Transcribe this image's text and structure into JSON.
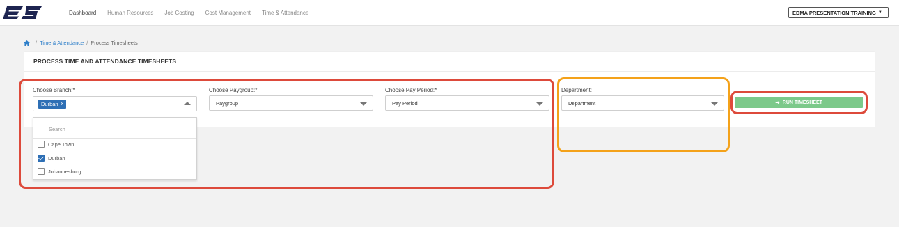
{
  "app": {
    "logo_text": "ES"
  },
  "nav": {
    "items": [
      "Dashboard",
      "Human Resources",
      "Job Costing",
      "Cost Management",
      "Time & Attendance"
    ],
    "active_index": 0
  },
  "company": {
    "label": "EDMA PRESENTATION TRAINING"
  },
  "breadcrumb": {
    "home_icon": "home-icon",
    "section": "Time & Attendance",
    "current": "Process Timesheets"
  },
  "page": {
    "title": "PROCESS TIME AND ATTENDANCE TIMESHEETS"
  },
  "form": {
    "branch": {
      "label": "Choose Branch:*",
      "selected_chip": "Durban",
      "chip_remove": "x"
    },
    "paygroup": {
      "label": "Choose Paygroup:*",
      "value": "Paygroup"
    },
    "pay_period": {
      "label": "Choose Pay Period:*",
      "value": "Pay Period"
    },
    "department": {
      "label": "Department:",
      "value": "Department"
    }
  },
  "branch_dropdown": {
    "search_placeholder": "Search",
    "options": [
      {
        "label": "Cape Town",
        "checked": false
      },
      {
        "label": "Durban",
        "checked": true
      },
      {
        "label": "Johannesburg",
        "checked": false
      }
    ]
  },
  "actions": {
    "run_label": "RUN TIMESHEET",
    "run_icon": "arrow-right-icon"
  },
  "colors": {
    "brand": "#1d2450",
    "chip": "#2e6fb5",
    "run_button": "#7cc98a",
    "annotation_red": "#dd4a3b",
    "annotation_orange": "#f4a21a",
    "link": "#2e7fc9"
  }
}
